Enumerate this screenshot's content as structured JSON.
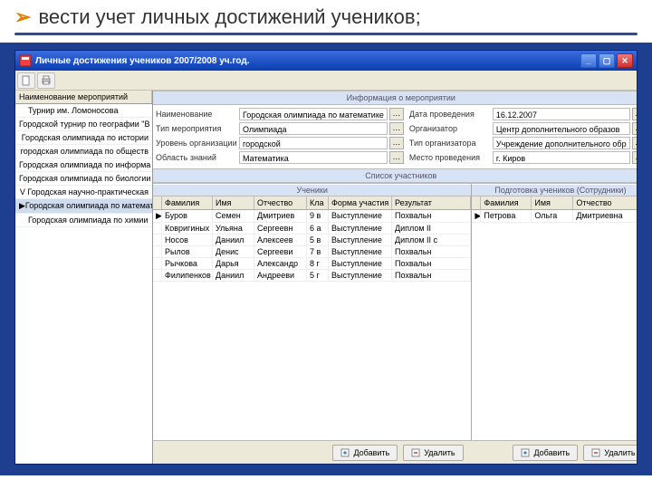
{
  "slide": {
    "title": "вести учет личных достижений учеников;"
  },
  "window": {
    "title": "Личные достижения учеников 2007/2008 уч.год."
  },
  "sidebar": {
    "header": "Наименование мероприятий",
    "items": [
      {
        "label": "Турнир им. Ломоносова",
        "selected": false
      },
      {
        "label": "Городской турнир по географии \"В",
        "selected": false
      },
      {
        "label": "Городская олимпиада по истории",
        "selected": false
      },
      {
        "label": "городская олимпиада по обществ",
        "selected": false
      },
      {
        "label": "Городская олимпиада по информа",
        "selected": false
      },
      {
        "label": "Городская олимпиада по биологии",
        "selected": false
      },
      {
        "label": "V Городская научно-практическая",
        "selected": false
      },
      {
        "label": "Городская олимпиада по математ",
        "selected": true
      },
      {
        "label": "Городская олимпиада по химии",
        "selected": false
      }
    ]
  },
  "info": {
    "band": "Информация о мероприятии",
    "left": [
      {
        "label": "Наименование",
        "value": "Городская олимпиада по математике"
      },
      {
        "label": "Тип мероприятия",
        "value": "Олимпиада"
      },
      {
        "label": "Уровень организации",
        "value": "городской"
      },
      {
        "label": "Область знаний",
        "value": "Математика"
      }
    ],
    "right": [
      {
        "label": "Дата проведения",
        "value": "16.12.2007"
      },
      {
        "label": "Организатор",
        "value": "Центр дополнительного образов"
      },
      {
        "label": "Тип организатора",
        "value": "Учреждение дополнительного обр"
      },
      {
        "label": "Место проведения",
        "value": "г. Киров"
      }
    ]
  },
  "participants": {
    "band": "Список участников",
    "leftTitle": "Ученики",
    "rightTitle": "Подготовка учеников (Сотрудники)",
    "cols": {
      "fam": "Фамилия",
      "name": "Имя",
      "otch": "Отчество",
      "kl": "Кла",
      "form": "Форма участия",
      "res": "Результат"
    },
    "rows": [
      {
        "fam": "Буров",
        "name": "Семен",
        "otch": "Дмитриев",
        "kl": "9 в",
        "form": "Выступление",
        "res": "Похвальн"
      },
      {
        "fam": "Ковригиных",
        "name": "Ульяна",
        "otch": "Сергеевн",
        "kl": "6 а",
        "form": "Выступление",
        "res": "Диплом II"
      },
      {
        "fam": "Носов",
        "name": "Даниил",
        "otch": "Алексеев",
        "kl": "5 в",
        "form": "Выступление",
        "res": "Диплом II с"
      },
      {
        "fam": "Рылов",
        "name": "Денис",
        "otch": "Сергееви",
        "kl": "7 в",
        "form": "Выступление",
        "res": "Похвальн"
      },
      {
        "fam": "Рычкова",
        "name": "Дарья",
        "otch": "Александр",
        "kl": "8 г",
        "form": "Выступление",
        "res": "Похвальн"
      },
      {
        "fam": "Филипенков",
        "name": "Даниил",
        "otch": "Андрееви",
        "kl": "5 г",
        "form": "Выступление",
        "res": "Похвальн"
      }
    ],
    "rcols": {
      "fam": "Фамилия",
      "name": "Имя",
      "otch": "Отчество"
    },
    "rrows": [
      {
        "fam": "Петрова",
        "name": "Ольга",
        "otch": "Дмитриевна"
      }
    ]
  },
  "buttons": {
    "add": "Добавить",
    "del": "Удалить"
  }
}
